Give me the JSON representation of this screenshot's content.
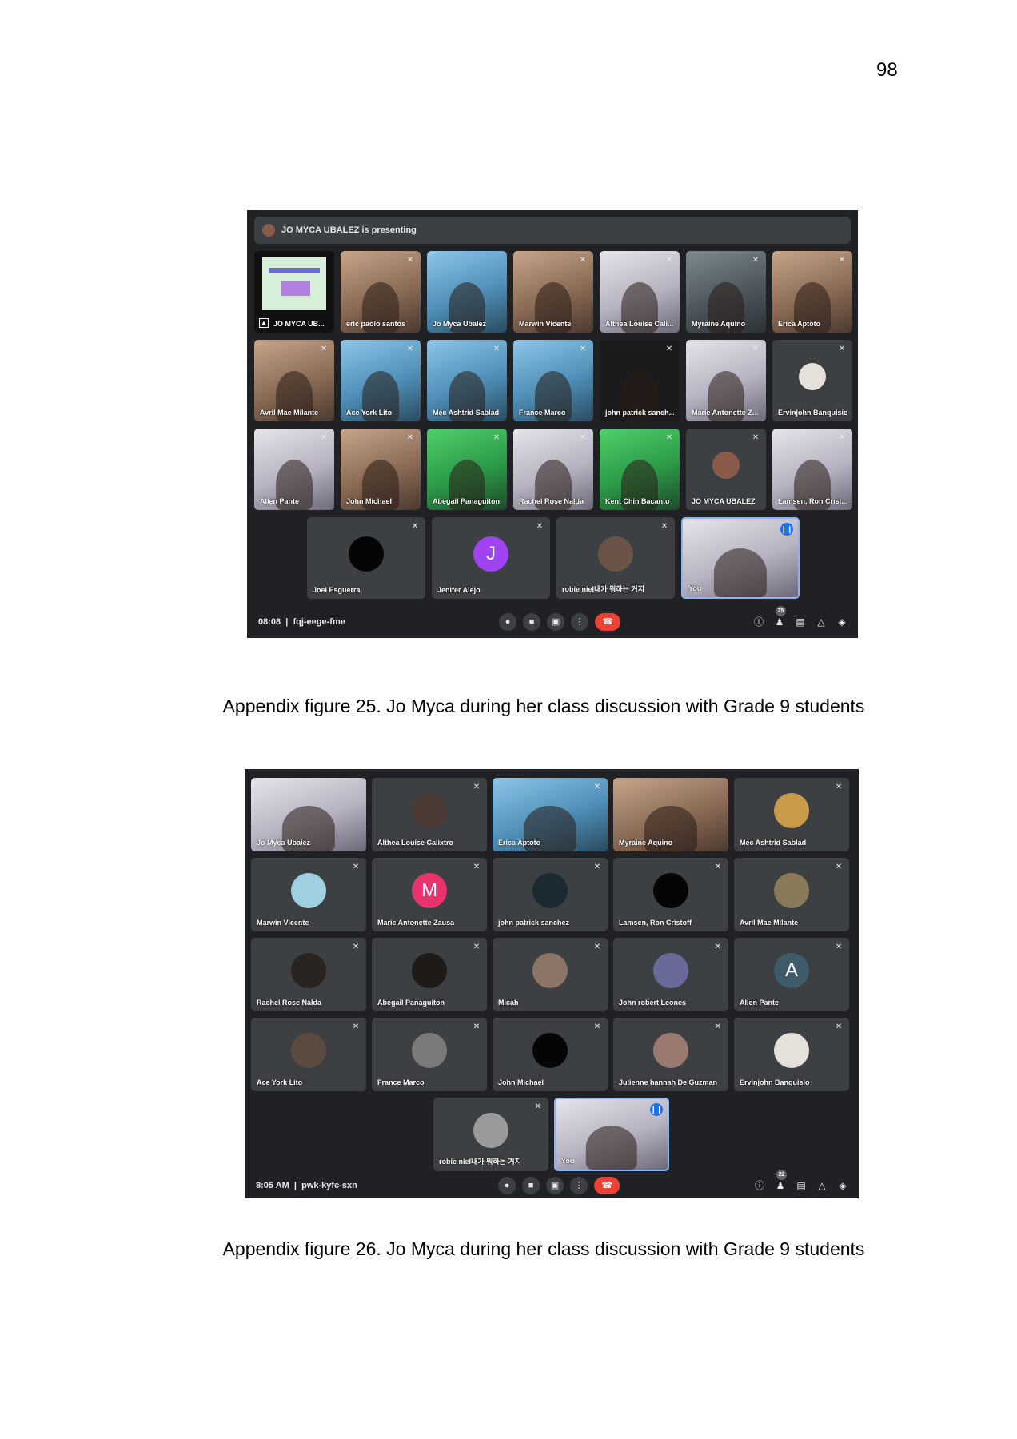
{
  "page_number": "98",
  "figure25": {
    "presenting_text": "JO MYCA UBALEZ is presenting",
    "time": "08:08",
    "meeting_code": "fqj-eege-fme",
    "participant_count": "25",
    "tiles": [
      "JO MYCA UB...",
      "eric paolo santos",
      "Jo Myca Ubalez",
      "Marwin Vicente",
      "Althea Louise Cali...",
      "Myraine Aquino",
      "Erica Aptoto",
      "Avril Mae Milante",
      "Ace York Lito",
      "Mec Ashtrid Sablad",
      "France Marco",
      "john patrick sanch...",
      "Marie Antonette Z...",
      "Ervinjohn Banquisio",
      "Allen Pante",
      "John Michael",
      "Abegail Panaguiton",
      "Rachel Rose Nalda",
      "Kent Chin Bacanto",
      "JO MYCA UBALEZ",
      "Lamsen, Ron Crist...",
      "Joel Esguerra",
      "Jenifer Alejo",
      "robie niel내가 뭐하는 거지",
      "You"
    ],
    "avatar_letters": {
      "jenifer": "J"
    },
    "caption": "Appendix figure 25. Jo Myca during her class discussion with Grade 9 students"
  },
  "figure26": {
    "time": "8:05 AM",
    "meeting_code": "pwk-kyfc-sxn",
    "participant_count": "22",
    "tiles": [
      "Jo Myca Ubalez",
      "Althea Louise Calixtro",
      "Erica Aptoto",
      "Myraine Aquino",
      "Mec Ashtrid Sablad",
      "Marwin Vicente",
      "Marie Antonette Zausa",
      "john patrick sanchez",
      "Lamsen, Ron Cristoff",
      "Avril Mae Milante",
      "Rachel Rose Nalda",
      "Abegail Panaguiton",
      "Micah",
      "John robert Leones",
      "Allen Pante",
      "Ace York Lito",
      "France Marco",
      "John Michael",
      "Julienne hannah De Guzman",
      "Ervinjohn Banquisio",
      "robie niel내가 뭐하는 거지",
      "You"
    ],
    "avatar_letters": {
      "marie": "M",
      "allen": "A"
    },
    "caption": "Appendix figure 26. Jo Myca during her class discussion with Grade 9 students"
  },
  "icons": {
    "muted": "mic-off-icon",
    "talking": "speaking-indicator-icon",
    "mic": "mic-icon",
    "camera": "camera-icon",
    "present": "present-screen-icon",
    "more": "more-options-icon",
    "end_call": "end-call-icon",
    "info": "info-icon",
    "people": "people-icon",
    "chat": "chat-icon",
    "activities": "activities-icon",
    "host_controls": "shield-icon"
  },
  "colors": {
    "meet_bg": "#202124",
    "tile_bg": "#3c4043",
    "end_call": "#ea4335",
    "active_border": "#8ab4f8"
  }
}
